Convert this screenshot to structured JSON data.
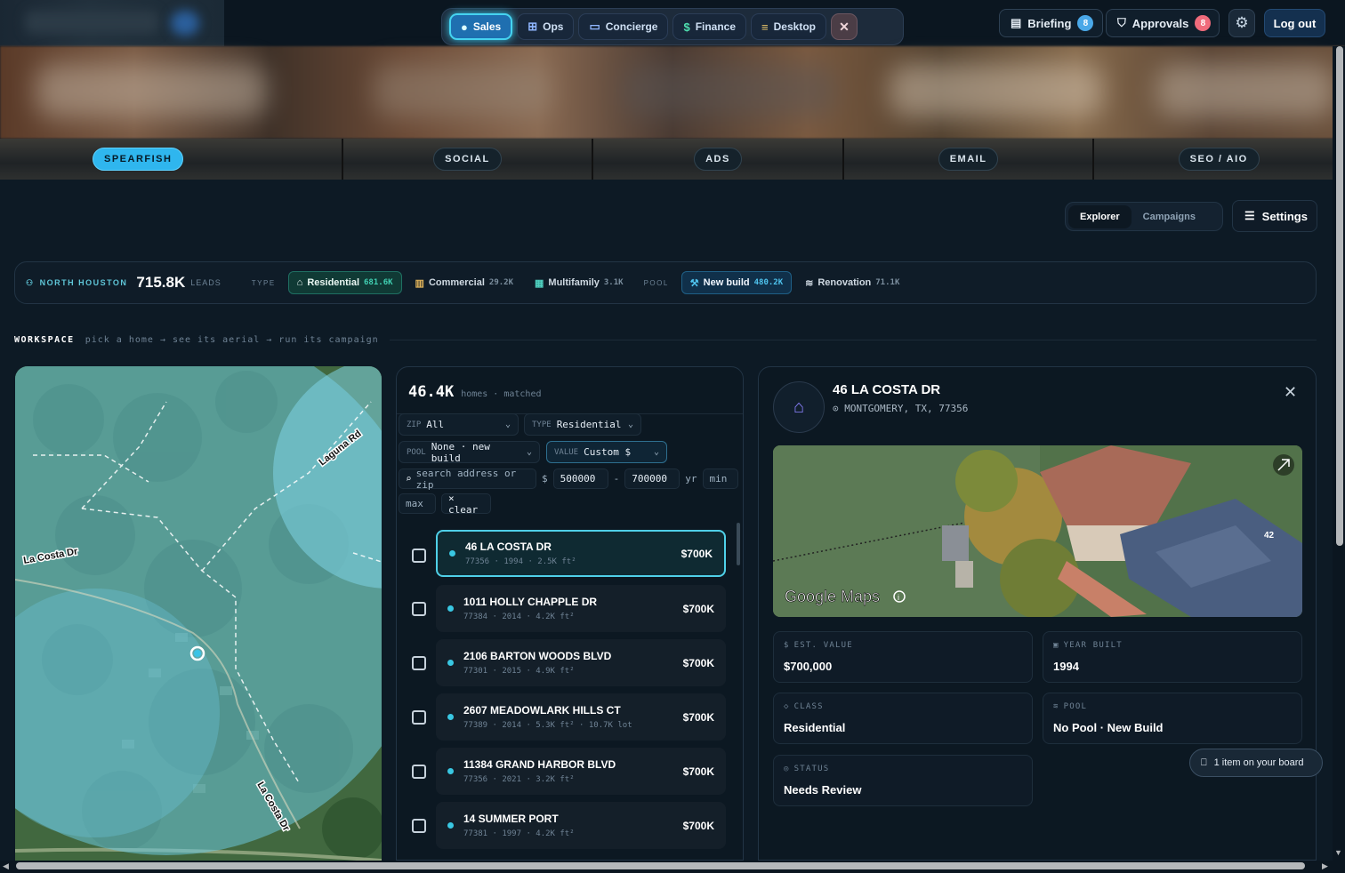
{
  "nav": {
    "items": [
      {
        "label": "Sales",
        "icon": "circle-dot-icon",
        "active": true
      },
      {
        "label": "Ops",
        "icon": "grid-icon"
      },
      {
        "label": "Concierge",
        "icon": "chat-icon"
      },
      {
        "label": "Finance",
        "icon": "dollar-icon"
      },
      {
        "label": "Desktop",
        "icon": "stack-icon"
      }
    ],
    "close_icon": "close-icon"
  },
  "header": {
    "briefing": {
      "label": "Briefing",
      "count": "8"
    },
    "approvals": {
      "label": "Approvals",
      "count": "8"
    },
    "logout": "Log out"
  },
  "channels": [
    {
      "label": "SPEARFISH",
      "active": true
    },
    {
      "label": "SOCIAL"
    },
    {
      "label": "ADS"
    },
    {
      "label": "EMAIL"
    },
    {
      "label": "SEO / AIO"
    }
  ],
  "view_tabs": {
    "explorer": "Explorer",
    "campaigns": "Campaigns",
    "settings": "Settings"
  },
  "stats": {
    "area": "NORTH HOUSTON",
    "leads_value": "715.8K",
    "leads_unit": "LEADS",
    "type_label": "TYPE",
    "types": [
      {
        "label": "Residential",
        "count": "681.6K"
      },
      {
        "label": "Commercial",
        "count": "29.2K"
      },
      {
        "label": "Multifamily",
        "count": "3.1K"
      }
    ],
    "pool_label": "POOL",
    "pools": [
      {
        "label": "New build",
        "count": "480.2K"
      },
      {
        "label": "Renovation",
        "count": "71.1K"
      }
    ]
  },
  "workspace": {
    "title": "WORKSPACE",
    "subtitle": "pick a home → see its aerial → run its campaign"
  },
  "map": {
    "labels": [
      "Laguna Rd",
      "La Costa Dr",
      "La Costa Dr"
    ]
  },
  "list": {
    "count": "46.4K",
    "count_label": "homes · matched",
    "filters": {
      "zip": {
        "key": "ZIP",
        "value": "All"
      },
      "type": {
        "key": "TYPE",
        "value": "Residential"
      },
      "pool": {
        "key": "POOL",
        "value": "None · new build"
      },
      "value": {
        "key": "VALUE",
        "value": "Custom $"
      }
    },
    "search_placeholder": "search address or zip",
    "dollar": "$",
    "min_price": "500000",
    "dash": "-",
    "max_price": "700000",
    "yr": "yr",
    "yr_min": "min",
    "yr_max": "max",
    "clear": "× clear",
    "items": [
      {
        "address": "46 LA COSTA DR",
        "meta": "77356 · 1994 · 2.5K ft²",
        "price": "$700K"
      },
      {
        "address": "1011 HOLLY CHAPPLE DR",
        "meta": "77384 · 2014 · 4.2K ft²",
        "price": "$700K"
      },
      {
        "address": "2106 BARTON WOODS BLVD",
        "meta": "77301 · 2015 · 4.9K ft²",
        "price": "$700K"
      },
      {
        "address": "2607 MEADOWLARK HILLS CT",
        "meta": "77389 · 2014 · 5.3K ft² · 10.7K lot",
        "price": "$700K"
      },
      {
        "address": "11384 GRAND HARBOR BLVD",
        "meta": "77356 · 2021 · 3.2K ft²",
        "price": "$700K"
      },
      {
        "address": "14 SUMMER PORT",
        "meta": "77381 · 1997 · 4.2K ft²",
        "price": "$700K"
      }
    ]
  },
  "detail": {
    "title": "46 LA COSTA DR",
    "location": "MONTGOMERY, TX, 77356",
    "map_brand": "Google Maps",
    "roof_number": "42",
    "cards": {
      "value": {
        "key": "EST. VALUE",
        "value": "$700,000"
      },
      "year": {
        "key": "YEAR BUILT",
        "value": "1994"
      },
      "class": {
        "key": "CLASS",
        "value": "Residential"
      },
      "pool": {
        "key": "POOL",
        "value": "No Pool · New Build"
      },
      "status": {
        "key": "STATUS",
        "value": "Needs Review"
      }
    }
  },
  "toast": "1 item on your board"
}
